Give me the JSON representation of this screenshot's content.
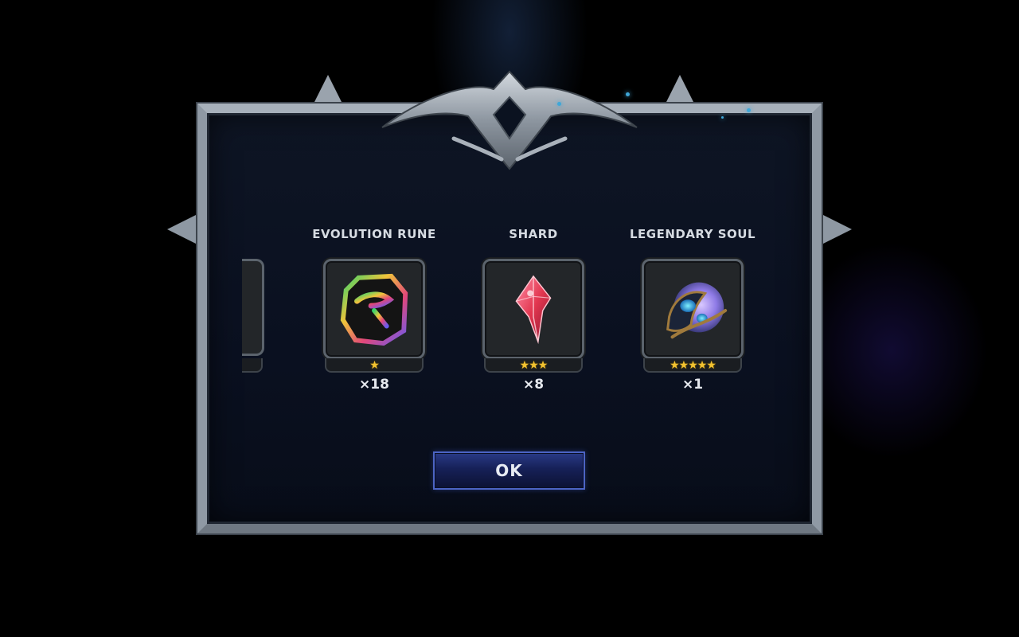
{
  "items": [
    {
      "name": "EVOLUTION RUNE",
      "stars": "★",
      "star_count": 1,
      "quantity": "×18",
      "icon": "evolution-rune-icon"
    },
    {
      "name": "SHARD",
      "stars": "★★★",
      "star_count": 3,
      "quantity": "×8",
      "icon": "shard-icon"
    },
    {
      "name": "LEGENDARY SOUL",
      "stars": "★★★★★",
      "star_count": 5,
      "quantity": "×1",
      "icon": "legendary-soul-icon"
    }
  ],
  "ok_label": "OK",
  "colors": {
    "frame": "#8f99a4",
    "panel": "#0b1220",
    "star": "#f2c230",
    "button": "#1c2766",
    "button_border": "#4c64c4"
  }
}
